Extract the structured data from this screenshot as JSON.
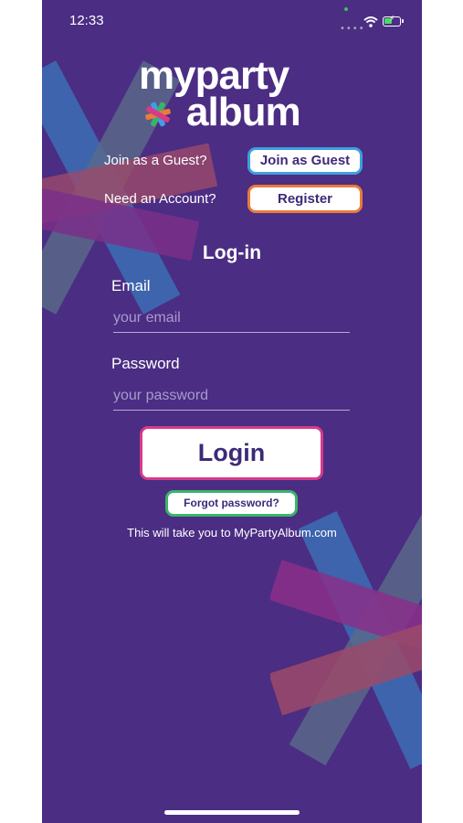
{
  "status_bar": {
    "time": "12:33",
    "signal": "••••",
    "icons": [
      "wifi-icon",
      "battery-charging-icon"
    ]
  },
  "logo": {
    "line1": "myparty",
    "line2": "album"
  },
  "guest_row": {
    "label": "Join as a Guest?",
    "button": "Join as Guest"
  },
  "register_row": {
    "label": "Need an Account?",
    "button": "Register"
  },
  "login_form": {
    "heading": "Log-in",
    "email_label": "Email",
    "email_placeholder": "your email",
    "email_value": "",
    "password_label": "Password",
    "password_placeholder": "your password",
    "password_value": "",
    "login_button": "Login",
    "forgot_button": "Forgot password?",
    "note": "This will take you to MyPartyAlbum.com"
  },
  "colors": {
    "background": "#4b2d83",
    "guest_border": "#3f9fe0",
    "register_border": "#ea7b3b",
    "login_border": "#d63b8a",
    "forgot_border": "#3bb36a",
    "button_text": "#3d2a78"
  }
}
